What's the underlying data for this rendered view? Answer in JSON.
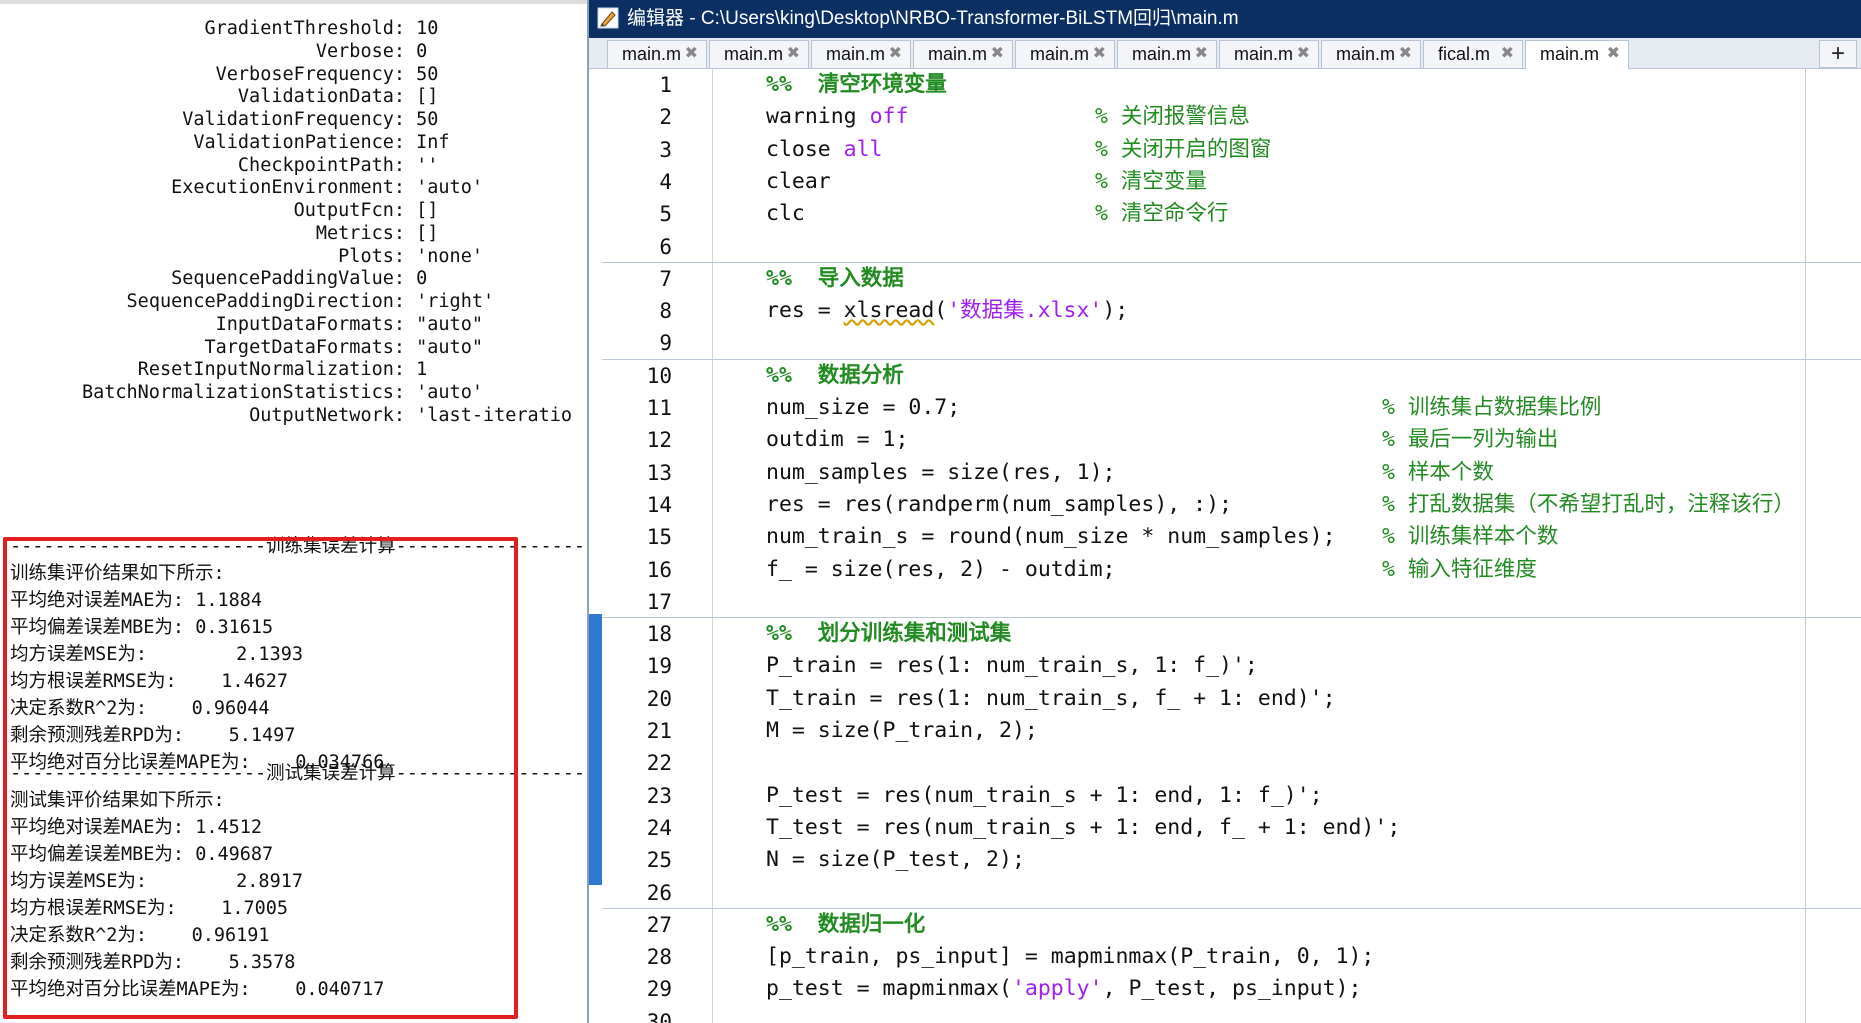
{
  "command_window": {
    "options": [
      {
        "key": "GradientThreshold:",
        "value": "10"
      },
      {
        "key": "Verbose:",
        "value": "0"
      },
      {
        "key": "VerboseFrequency:",
        "value": "50"
      },
      {
        "key": "ValidationData:",
        "value": "[]"
      },
      {
        "key": "ValidationFrequency:",
        "value": "50"
      },
      {
        "key": "ValidationPatience:",
        "value": "Inf"
      },
      {
        "key": "CheckpointPath:",
        "value": "''"
      },
      {
        "key": "ExecutionEnvironment:",
        "value": "'auto'"
      },
      {
        "key": "OutputFcn:",
        "value": "[]"
      },
      {
        "key": "Metrics:",
        "value": "[]"
      },
      {
        "key": "Plots:",
        "value": "'none'"
      },
      {
        "key": "SequencePaddingValue:",
        "value": "0"
      },
      {
        "key": "SequencePaddingDirection:",
        "value": "'right'"
      },
      {
        "key": "InputDataFormats:",
        "value": "\"auto\""
      },
      {
        "key": "TargetDataFormats:",
        "value": "\"auto\""
      },
      {
        "key": "ResetInputNormalization:",
        "value": "1"
      },
      {
        "key": "BatchNormalizationStatistics:",
        "value": "'auto'"
      },
      {
        "key": "OutputNetwork:",
        "value": "'last-iteratio"
      }
    ],
    "train_separator": "-----------------------训练集误差计算-----------------------",
    "train_header": "训练集评价结果如下所示:",
    "train_results": [
      "平均绝对误差MAE为: 1.1884",
      "平均偏差误差MBE为: 0.31615",
      "均方误差MSE为:        2.1393",
      "均方根误差RMSE为:    1.4627",
      "决定系数R^2为:    0.96044",
      "剩余预测残差RPD为:    5.1497",
      "平均绝对百分比误差MAPE为:    0.034766"
    ],
    "test_separator": "-----------------------测试集误差计算-----------------------",
    "test_header": "测试集评价结果如下所示:",
    "test_results": [
      "平均绝对误差MAE为: 1.4512",
      "平均偏差误差MBE为: 0.49687",
      "均方误差MSE为:        2.8917",
      "均方根误差RMSE为:    1.7005",
      "决定系数R^2为:    0.96191",
      "剩余预测残差RPD为:    5.3578",
      "平均绝对百分比误差MAPE为:    0.040717"
    ],
    "highlight_color": "#e21f1f"
  },
  "editor": {
    "title": "编辑器 - C:\\Users\\king\\Desktop\\NRBO-Transformer-BiLSTM回归\\main.m",
    "tabs": [
      "main.m",
      "main.m",
      "main.m",
      "main.m",
      "main.m",
      "main.m",
      "main.m",
      "main.m",
      "fical.m",
      "main.m"
    ],
    "active_tab_index": 9,
    "add_tab_label": "+",
    "lines": [
      {
        "n": "1",
        "code": "%%  清空环境变量",
        "comment": ""
      },
      {
        "n": "2",
        "code": "warning off",
        "comment": "% 关闭报警信息"
      },
      {
        "n": "3",
        "code": "close all",
        "comment": "% 关闭开启的图窗"
      },
      {
        "n": "4",
        "code": "clear",
        "comment": "% 清空变量"
      },
      {
        "n": "5",
        "code": "clc",
        "comment": "% 清空命令行"
      },
      {
        "n": "6",
        "code": "",
        "comment": ""
      },
      {
        "n": "7",
        "code": "%%  导入数据",
        "comment": ""
      },
      {
        "n": "8",
        "code": "res = xlsread('数据集.xlsx');",
        "comment": ""
      },
      {
        "n": "9",
        "code": "",
        "comment": ""
      },
      {
        "n": "10",
        "code": "%%  数据分析",
        "comment": ""
      },
      {
        "n": "11",
        "code": "num_size = 0.7;",
        "comment": "% 训练集占数据集比例"
      },
      {
        "n": "12",
        "code": "outdim = 1;",
        "comment": "% 最后一列为输出"
      },
      {
        "n": "13",
        "code": "num_samples = size(res, 1);",
        "comment": "% 样本个数"
      },
      {
        "n": "14",
        "code": "res = res(randperm(num_samples), :);",
        "comment": "% 打乱数据集（不希望打乱时，注释该行）"
      },
      {
        "n": "15",
        "code": "num_train_s = round(num_size * num_samples);",
        "comment": "% 训练集样本个数"
      },
      {
        "n": "16",
        "code": "f_ = size(res, 2) - outdim;",
        "comment": "% 输入特征维度"
      },
      {
        "n": "17",
        "code": "",
        "comment": ""
      },
      {
        "n": "18",
        "code": "%%  划分训练集和测试集",
        "comment": ""
      },
      {
        "n": "19",
        "code": "P_train = res(1: num_train_s, 1: f_)';",
        "comment": ""
      },
      {
        "n": "20",
        "code": "T_train = res(1: num_train_s, f_ + 1: end)';",
        "comment": ""
      },
      {
        "n": "21",
        "code": "M = size(P_train, 2);",
        "comment": ""
      },
      {
        "n": "22",
        "code": "",
        "comment": ""
      },
      {
        "n": "23",
        "code": "P_test = res(num_train_s + 1: end, 1: f_)';",
        "comment": ""
      },
      {
        "n": "24",
        "code": "T_test = res(num_train_s + 1: end, f_ + 1: end)';",
        "comment": ""
      },
      {
        "n": "25",
        "code": "N = size(P_test, 2);",
        "comment": ""
      },
      {
        "n": "26",
        "code": "",
        "comment": ""
      },
      {
        "n": "27",
        "code": "%%  数据归一化",
        "comment": ""
      },
      {
        "n": "28",
        "code": "[p_train, ps_input] = mapminmax(P_train, 0, 1);",
        "comment": ""
      },
      {
        "n": "29",
        "code": "p_test = mapminmax('apply', P_test, ps_input);",
        "comment": ""
      },
      {
        "n": "30",
        "code": "",
        "comment": ""
      }
    ],
    "colors": {
      "title_bg": "#0b2e63",
      "comment": "#228b22",
      "keyword": "#a020f0",
      "selection_bar": "#2f7ad0"
    }
  }
}
